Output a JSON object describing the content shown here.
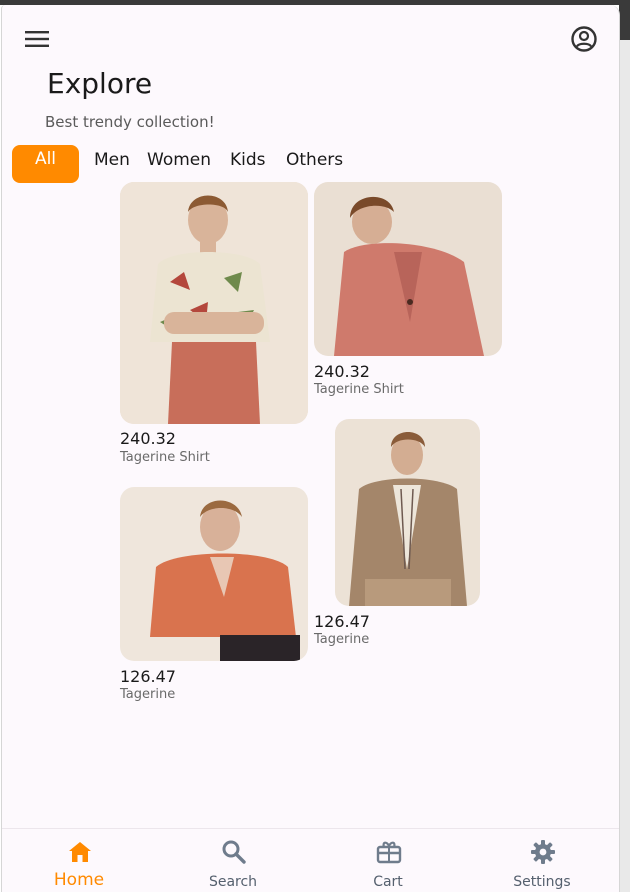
{
  "header": {
    "menu_icon": "hamburger-menu-icon",
    "profile_icon": "account-circle-icon",
    "title": "Explore",
    "subtitle": "Best trendy collection!"
  },
  "tabs": [
    {
      "label": "All",
      "active": true
    },
    {
      "label": "Men",
      "active": false
    },
    {
      "label": "Women",
      "active": false
    },
    {
      "label": "Kids",
      "active": false
    },
    {
      "label": "Others",
      "active": false
    }
  ],
  "products": [
    {
      "price": "240.32",
      "name": "Tagerine Shirt"
    },
    {
      "price": "240.32",
      "name": "Tagerine Shirt"
    },
    {
      "price": "126.47",
      "name": "Tagerine"
    },
    {
      "price": "126.47",
      "name": "Tagerine"
    }
  ],
  "bottom_nav": [
    {
      "label": "Home",
      "icon": "home-icon",
      "active": true
    },
    {
      "label": "Search",
      "icon": "search-icon",
      "active": false
    },
    {
      "label": "Cart",
      "icon": "cart-icon",
      "active": false
    },
    {
      "label": "Settings",
      "icon": "gear-icon",
      "active": false
    }
  ],
  "colors": {
    "accent": "#ff8a00",
    "inactive_icon": "#6f7c8c",
    "background": "#fdf9fd"
  }
}
